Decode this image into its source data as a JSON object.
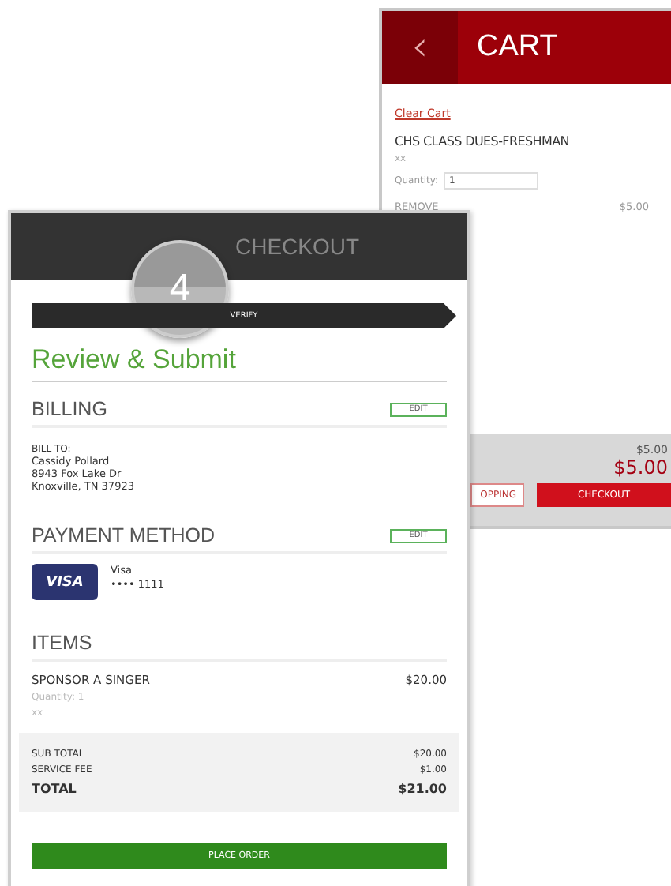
{
  "cart": {
    "title": "CART",
    "back_icon": "‹",
    "clear_link": "Clear Cart",
    "item": {
      "name": "CHS CLASS DUES-FRESHMAN",
      "note": "xx",
      "quantity_label": "Quantity:",
      "quantity": "1",
      "remove": "REMOVE",
      "price": "$5.00"
    },
    "subtotal": "$5.00",
    "total": "$5.00",
    "continue_button": "OPPING",
    "checkout_button": "CHECKOUT"
  },
  "checkout": {
    "title": "CHECKOUT",
    "step_number": "4",
    "step_label": "VERIFY",
    "heading": "Review & Submit",
    "billing": {
      "title": "BILLING",
      "edit": "EDIT",
      "label": "BILL TO:",
      "lines": [
        "Cassidy Pollard",
        "8943 Fox Lake Dr",
        "Knoxville, TN 37923"
      ]
    },
    "payment": {
      "title": "PAYMENT METHOD",
      "edit": "EDIT",
      "card_logo": "VISA",
      "card_name": "Visa",
      "card_number": "•••• 1111"
    },
    "items": {
      "title": "ITEMS",
      "list": [
        {
          "name": "SPONSOR A SINGER",
          "price": "$20.00",
          "quantity": "Quantity: 1",
          "note": "xx"
        }
      ]
    },
    "totals": [
      {
        "label": "SUB TOTAL",
        "value": "$20.00",
        "kind": "line"
      },
      {
        "label": "SERVICE FEE",
        "value": "$1.00",
        "kind": "line"
      },
      {
        "label": "TOTAL",
        "value": "$21.00",
        "kind": "total"
      }
    ],
    "place_order": "PLACE ORDER"
  }
}
